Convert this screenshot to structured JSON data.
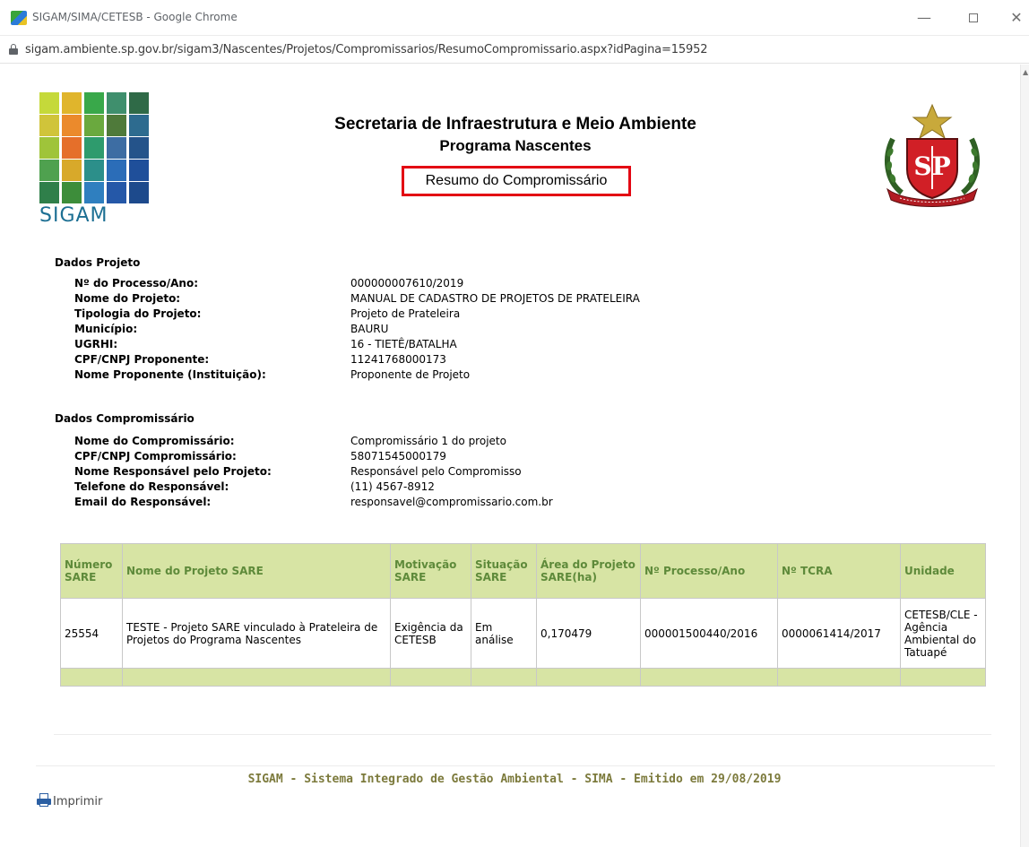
{
  "browser": {
    "window_title": "SIGAM/SIMA/CETESB - Google Chrome",
    "url": "sigam.ambiente.sp.gov.br/sigam3/Nascentes/Projetos/Compromissarios/ResumoCompromissario.aspx?idPagina=15952"
  },
  "header": {
    "logo_text": "SIGAM",
    "title": "Secretaria de Infraestrutura e Meio Ambiente",
    "subtitle": "Programa Nascentes",
    "page_heading": "Resumo do Compromissário"
  },
  "dados_projeto": {
    "section_title": "Dados Projeto",
    "fields": [
      {
        "label": "Nº do Processo/Ano:",
        "value": "000000007610/2019"
      },
      {
        "label": "Nome do Projeto:",
        "value": "MANUAL DE CADASTRO DE PROJETOS DE PRATELEIRA"
      },
      {
        "label": "Tipologia do Projeto:",
        "value": "Projeto de Prateleira"
      },
      {
        "label": "Município:",
        "value": "BAURU"
      },
      {
        "label": "UGRHI:",
        "value": "16 - TIETÊ/BATALHA"
      },
      {
        "label": "CPF/CNPJ Proponente:",
        "value": "11241768000173"
      },
      {
        "label": "Nome Proponente (Instituição):",
        "value": "Proponente de Projeto"
      }
    ]
  },
  "dados_compromissario": {
    "section_title": "Dados Compromissário",
    "fields": [
      {
        "label": "Nome do Compromissário:",
        "value": "Compromissário 1 do projeto"
      },
      {
        "label": "CPF/CNPJ Compromissário:",
        "value": "58071545000179"
      },
      {
        "label": "Nome Responsável pelo Projeto:",
        "value": "Responsável pelo Compromisso"
      },
      {
        "label": "Telefone do Responsável:",
        "value": "(11) 4567-8912"
      },
      {
        "label": "Email do Responsável:",
        "value": "responsavel@compromissario.com.br"
      }
    ]
  },
  "sare_table": {
    "columns": [
      "Número SARE",
      "Nome do Projeto SARE",
      "Motivação SARE",
      "Situação SARE",
      "Área do Projeto SARE(ha)",
      "Nº Processo/Ano",
      "Nº TCRA",
      "Unidade"
    ],
    "rows": [
      [
        "25554",
        "TESTE - Projeto SARE vinculado à Prateleira de Projetos do Programa Nascentes",
        "Exigência da CETESB",
        "Em análise",
        "0,170479",
        "000001500440/2016",
        "0000061414/2017",
        "CETESB/CLE - Agência Ambiental do Tatuapé"
      ]
    ]
  },
  "footer": {
    "text": "SIGAM - Sistema Integrado de Gestão Ambiental - SIMA - Emitido em 29/08/2019",
    "print_label": "Imprimir"
  },
  "colors": {
    "table_header_bg": "#d7e4a4",
    "table_header_text": "#5e8a3a",
    "highlight_border": "#e30613",
    "footer_text": "#7c7a3c"
  }
}
